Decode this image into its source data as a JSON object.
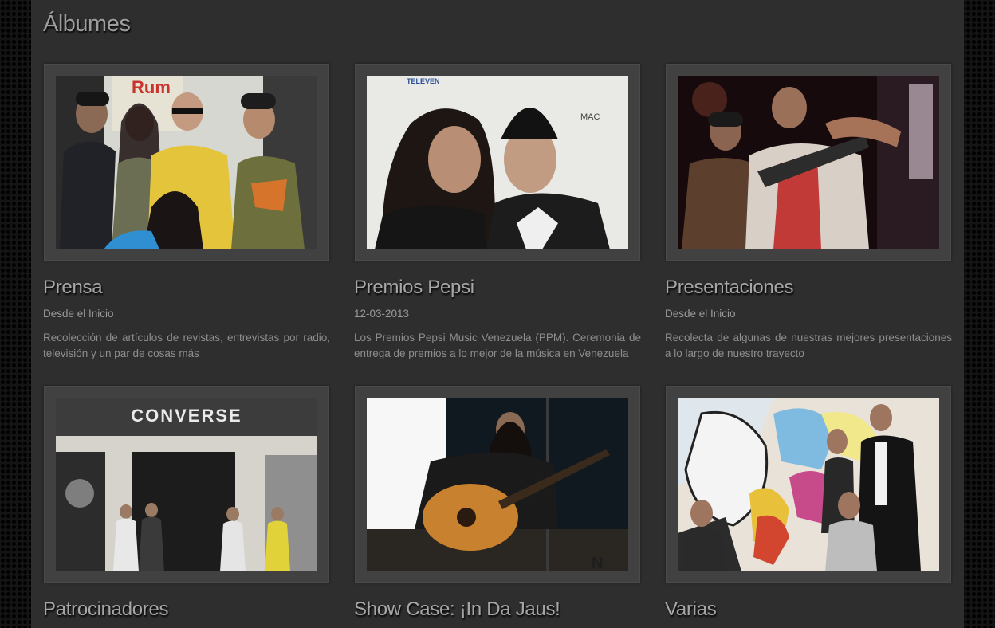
{
  "page": {
    "title": "Álbumes"
  },
  "albums": [
    {
      "title": "Prensa",
      "date": "Desde el Inicio",
      "description": "Recolección de artículos de revistas, entrevistas por radio, televisión y un par de cosas más"
    },
    {
      "title": "Premios Pepsi",
      "date": "12-03-2013",
      "description": "Los Premios Pepsi Music Venezuela (PPM). Ceremonia de entrega de premios a lo mejor de la música en Venezuela"
    },
    {
      "title": "Presentaciones",
      "date": "Desde el Inicio",
      "description": "Recolecta de algunas de nuestras mejores presentaciones a lo largo de nuestro trayecto"
    },
    {
      "title": "Patrocinadores",
      "date": "",
      "description": ""
    },
    {
      "title": "Show Case: ¡In Da Jaus!",
      "date": "",
      "description": ""
    },
    {
      "title": "Varias",
      "date": "",
      "description": ""
    }
  ],
  "photo_text": {
    "converse_sign": "CONVERSE",
    "televen": "TELEVEN",
    "mac": "MAC",
    "watermark": "N"
  }
}
